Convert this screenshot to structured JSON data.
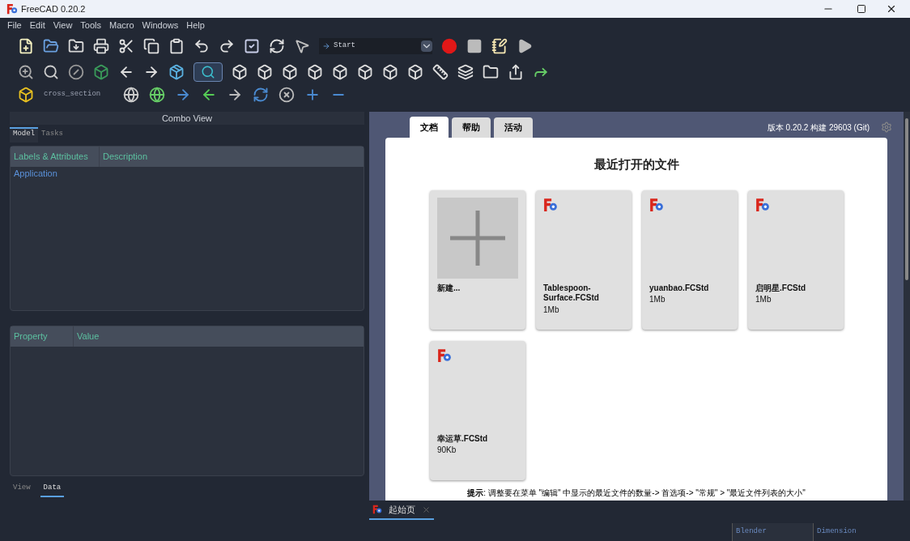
{
  "window": {
    "title": "FreeCAD 0.20.2"
  },
  "menu": [
    "File",
    "Edit",
    "View",
    "Tools",
    "Macro",
    "Windows",
    "Help"
  ],
  "toolbar": {
    "macro_combo": "Start",
    "workbench_label": "cross_section"
  },
  "combo_view": {
    "title": "Combo View",
    "tabs": [
      {
        "label": "Model",
        "selected": true
      },
      {
        "label": "Tasks",
        "selected": false
      }
    ],
    "tree_columns": [
      "Labels & Attributes",
      "Description"
    ],
    "tree_items": [
      "Application"
    ],
    "property_columns": [
      "Property",
      "Value"
    ],
    "bottom_tabs": [
      {
        "label": "View",
        "selected": false
      },
      {
        "label": "Data",
        "selected": true
      }
    ]
  },
  "start_page": {
    "tabs": [
      {
        "label": "文档",
        "selected": true
      },
      {
        "label": "帮助",
        "selected": false
      },
      {
        "label": "活动",
        "selected": false
      }
    ],
    "version": "版本 0.20.2 构建 29603 (Git)",
    "heading": "最近打开的文件",
    "files": [
      {
        "kind": "new",
        "name": "新建..."
      },
      {
        "kind": "file",
        "name": "Tablespoon-Surface.FCStd",
        "size": "1Mb"
      },
      {
        "kind": "file",
        "name": "yuanbao.FCStd",
        "size": "1Mb"
      },
      {
        "kind": "file",
        "name": "启明星.FCStd",
        "size": "1Mb"
      },
      {
        "kind": "file",
        "name": "幸运草.FCStd",
        "size": "90Kb"
      }
    ],
    "hint": "**提示**: 调整要在菜单 \"编辑\" 中显示的最近文件的数量-> 首选项-> \"常规\" > \"最近文件列表的大小\""
  },
  "document_tabs": [
    {
      "label": "起始页",
      "selected": true
    }
  ],
  "status_bar": [
    "Blender",
    "Dimension"
  ]
}
